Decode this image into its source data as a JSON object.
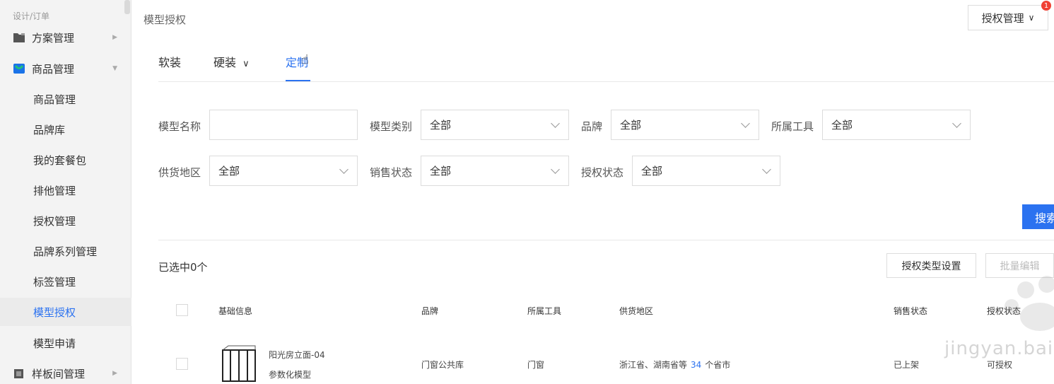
{
  "sidebar": {
    "breadcrumb": "设计/订单",
    "groups": [
      {
        "label": "方案管理"
      },
      {
        "label": "商品管理"
      },
      {
        "label": "样板间管理"
      }
    ],
    "items": [
      {
        "label": "商品管理"
      },
      {
        "label": "品牌库"
      },
      {
        "label": "我的套餐包"
      },
      {
        "label": "排他管理"
      },
      {
        "label": "授权管理"
      },
      {
        "label": "品牌系列管理"
      },
      {
        "label": "标签管理"
      },
      {
        "label": "模型授权"
      },
      {
        "label": "模型申请"
      }
    ]
  },
  "header": {
    "title": "模型授权",
    "auth_menu": "授权管理",
    "badge": "1"
  },
  "tabs": [
    {
      "label": "软装"
    },
    {
      "label": "硬装"
    },
    {
      "label": "定制"
    }
  ],
  "filters": {
    "model_name": {
      "label": "模型名称",
      "value": ""
    },
    "model_category": {
      "label": "模型类别",
      "value": "全部"
    },
    "brand": {
      "label": "品牌",
      "value": "全部"
    },
    "tool": {
      "label": "所属工具",
      "value": "全部"
    },
    "supply_region": {
      "label": "供货地区",
      "value": "全部"
    },
    "sale_status": {
      "label": "销售状态",
      "value": "全部"
    },
    "auth_status": {
      "label": "授权状态",
      "value": "全部"
    },
    "search_label": "搜索"
  },
  "table": {
    "selected_count": "已选中0个",
    "auth_type_btn": "授权类型设置",
    "batch_edit_btn": "批量编辑",
    "columns": [
      "基础信息",
      "品牌",
      "所属工具",
      "供货地区",
      "销售状态",
      "授权状态"
    ],
    "rows": [
      {
        "name": "阳光房立面-04",
        "type": "参数化模型",
        "brand": "门窗公共库",
        "tool": "门窗",
        "region_prefix": "浙江省、湖南省等",
        "region_count": "34",
        "region_suffix": "个省市",
        "sale_status": "已上架",
        "auth_status": "可授权"
      }
    ]
  },
  "watermark": "jingyan.baidu.com",
  "colors": {
    "accent": "#2b72f0",
    "badge": "#f04134",
    "sidebar_bg": "#f3f3f3"
  }
}
